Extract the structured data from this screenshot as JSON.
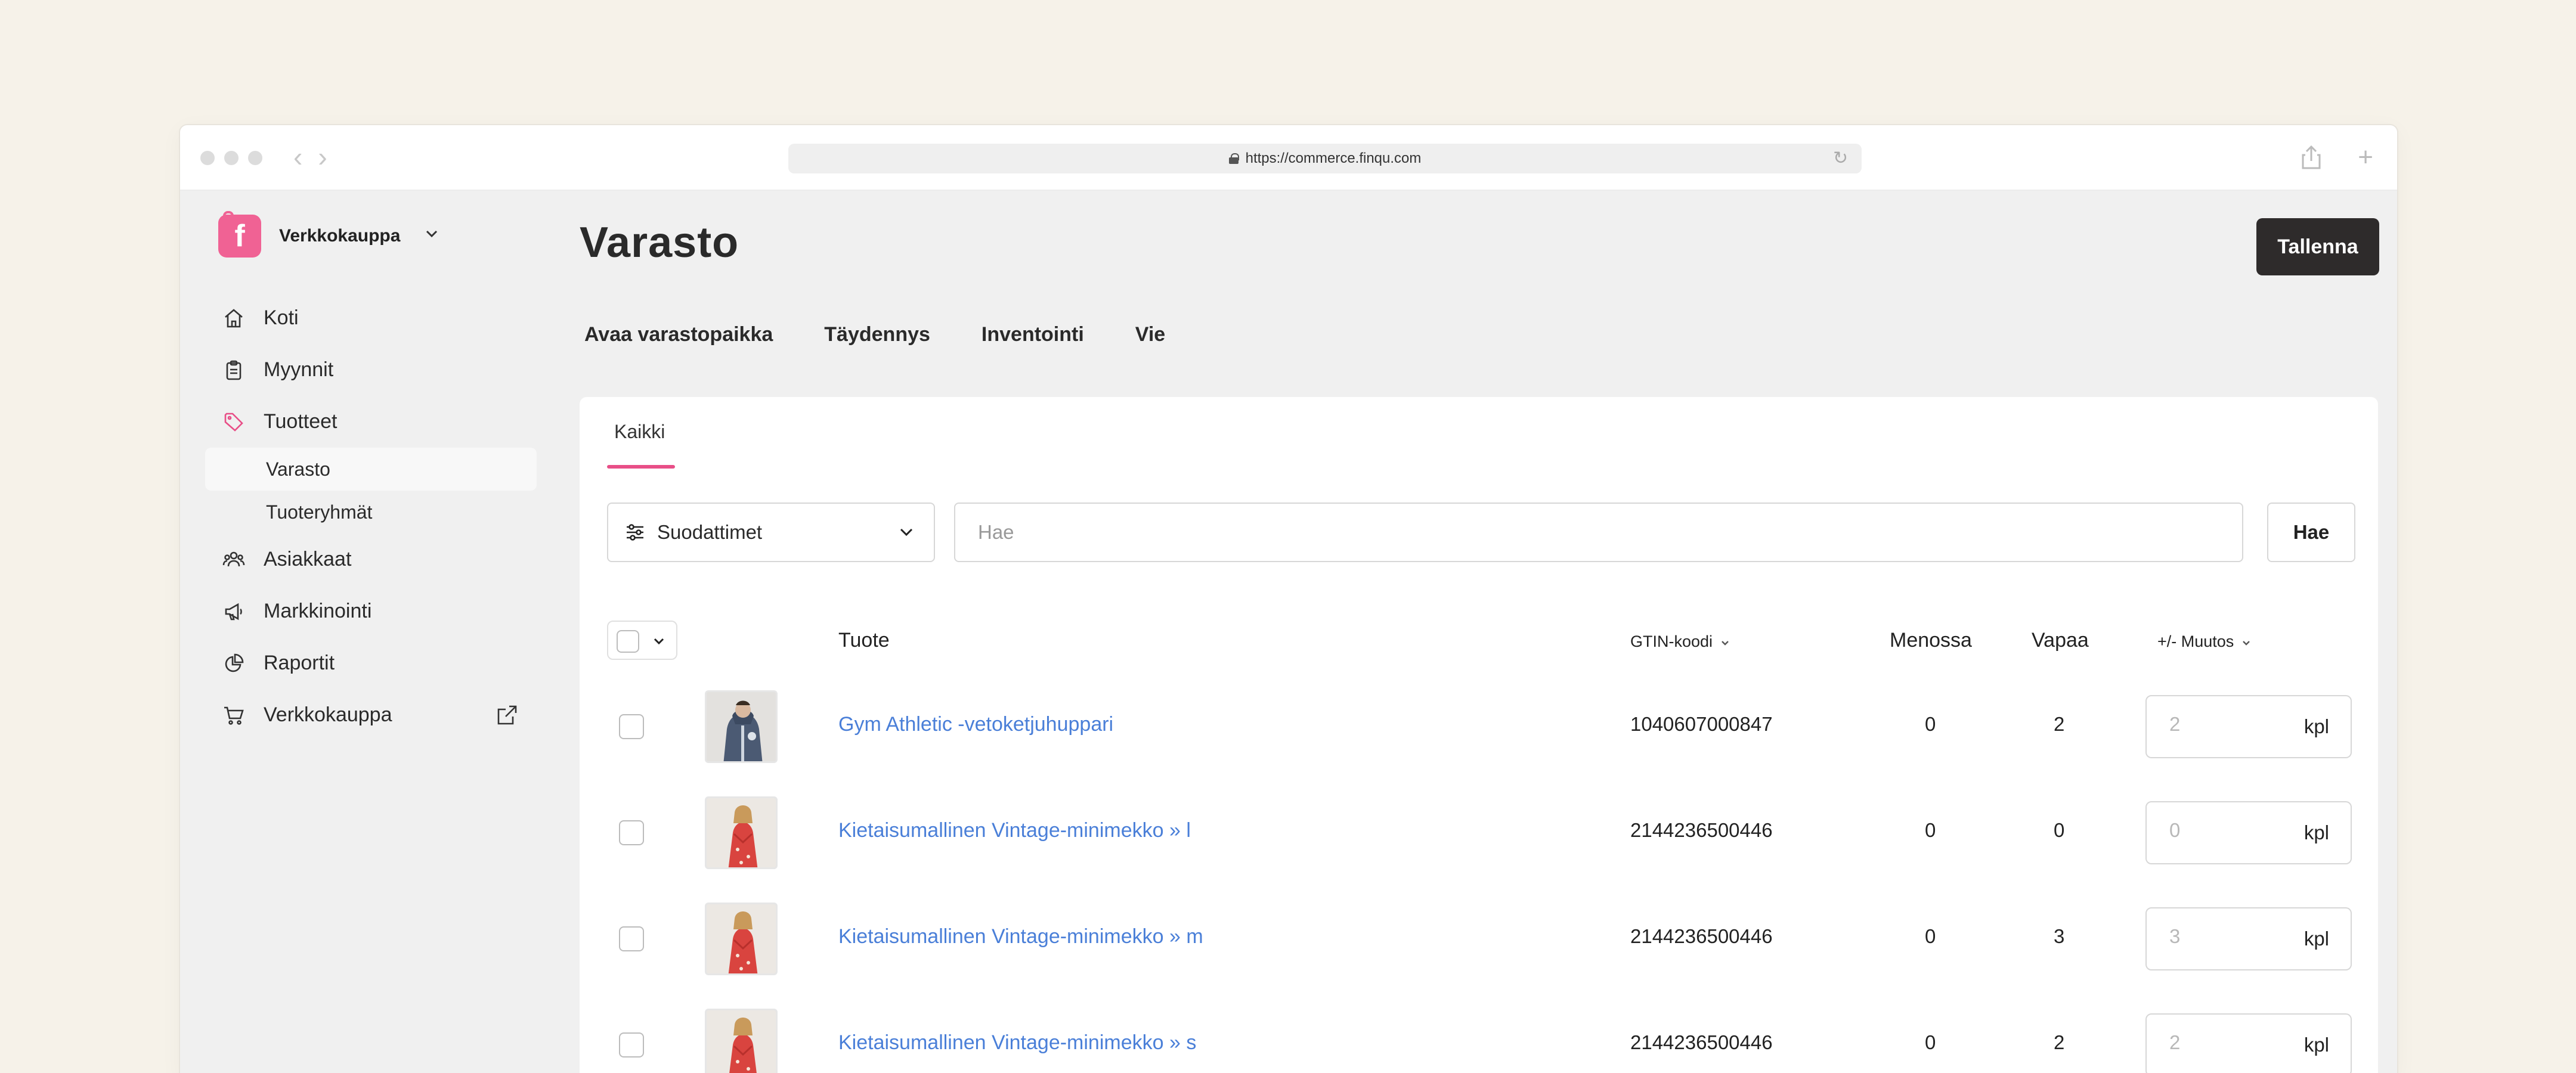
{
  "browser": {
    "url": "https://commerce.finqu.com"
  },
  "sidebar": {
    "store_name": "Verkkokauppa",
    "items": [
      {
        "label": "Koti",
        "icon": "home-icon"
      },
      {
        "label": "Myynnit",
        "icon": "clipboard-icon"
      },
      {
        "label": "Tuotteet",
        "icon": "tag-icon"
      },
      {
        "label": "Varasto",
        "sub": true,
        "active": true
      },
      {
        "label": "Tuoteryhmät",
        "sub": true
      },
      {
        "label": "Asiakkaat",
        "icon": "users-icon"
      },
      {
        "label": "Markkinointi",
        "icon": "megaphone-icon"
      },
      {
        "label": "Raportit",
        "icon": "pie-chart-icon"
      },
      {
        "label": "Verkkokauppa",
        "icon": "cart-icon"
      }
    ]
  },
  "page": {
    "title": "Varasto",
    "save_label": "Tallenna",
    "actions": [
      "Avaa varastopaikka",
      "Täydennys",
      "Inventointi",
      "Vie"
    ]
  },
  "card": {
    "tab_label": "Kaikki",
    "filter_label": "Suodattimet",
    "search_placeholder": "Hae",
    "search_button": "Hae"
  },
  "table": {
    "headers": {
      "product": "Tuote",
      "gtin": "GTIN-koodi",
      "outgoing": "Menossa",
      "free": "Vapaa",
      "change": "+/- Muutos"
    },
    "unit": "kpl",
    "rows": [
      {
        "name": "Gym Athletic -vetoketjuhuppari",
        "gtin": "1040607000847",
        "outgoing": "0",
        "free": "2",
        "change_placeholder": "2",
        "thumb": "hoodie"
      },
      {
        "name": "Kietaisumallinen Vintage-minimekko » l",
        "gtin": "2144236500446",
        "outgoing": "0",
        "free": "0",
        "change_placeholder": "0",
        "thumb": "dress"
      },
      {
        "name": "Kietaisumallinen Vintage-minimekko » m",
        "gtin": "2144236500446",
        "outgoing": "0",
        "free": "3",
        "change_placeholder": "3",
        "thumb": "dress"
      },
      {
        "name": "Kietaisumallinen Vintage-minimekko » s",
        "gtin": "2144236500446",
        "outgoing": "0",
        "free": "2",
        "change_placeholder": "2",
        "thumb": "dress"
      }
    ]
  },
  "colors": {
    "accent": "#e84e87",
    "link": "#4a7fd8",
    "primary_button": "#2e2b2b",
    "logo": "#f06294"
  }
}
